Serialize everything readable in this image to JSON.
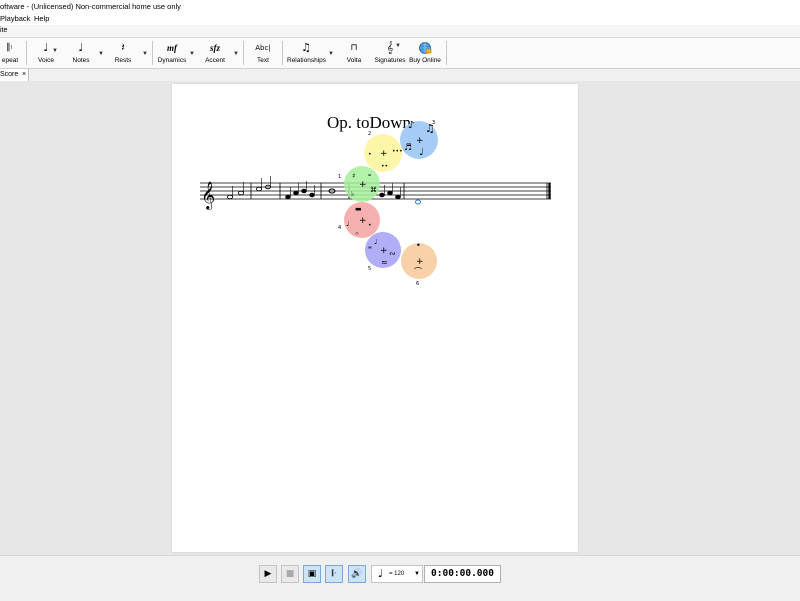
{
  "window": {
    "title": "oftware - (Unlicensed) Non-commercial home use only"
  },
  "menu": {
    "items": [
      "Playback",
      "Help"
    ]
  },
  "secondary_row": {
    "label": "ite"
  },
  "toolbar": {
    "items": [
      {
        "label": "epeat",
        "icon": "repeat-barline-icon"
      },
      {
        "label": "Voice",
        "icon": "voice-note-icon"
      },
      {
        "label": "Notes",
        "icon": "quarter-note-icon"
      },
      {
        "label": "Rests",
        "icon": "quarter-rest-icon"
      },
      {
        "label": "Dynamics",
        "icon": "dynamics-mf-icon"
      },
      {
        "label": "Accent",
        "icon": "accent-sfz-icon"
      },
      {
        "label": "Text",
        "icon": "text-abc-icon"
      },
      {
        "label": "Relationships",
        "icon": "slur-notes-icon"
      },
      {
        "label": "Volta",
        "icon": "volta-bracket-icon"
      },
      {
        "label": "Signatures",
        "icon": "treble-clef-icon"
      },
      {
        "label": "Buy Online",
        "icon": "globe-cart-icon"
      }
    ],
    "text_icon_glyph": "Abc|",
    "dynamics_glyph": "mf",
    "accent_glyph": "sfz"
  },
  "tab": {
    "label": "Score",
    "close": "×"
  },
  "score": {
    "title": "Op. toDown"
  },
  "palette": {
    "labels": [
      "1",
      "2",
      "3",
      "4",
      "5",
      "6"
    ],
    "colors": {
      "yellow": "#fbf59a",
      "blue": "#9cc6f5",
      "green": "#a4f09a",
      "red": "#f5a2a2",
      "purple": "#a8a4f5",
      "orange": "#f8c898"
    }
  },
  "transport": {
    "tempo_value": "= 120",
    "time": "0:00:00.000"
  }
}
